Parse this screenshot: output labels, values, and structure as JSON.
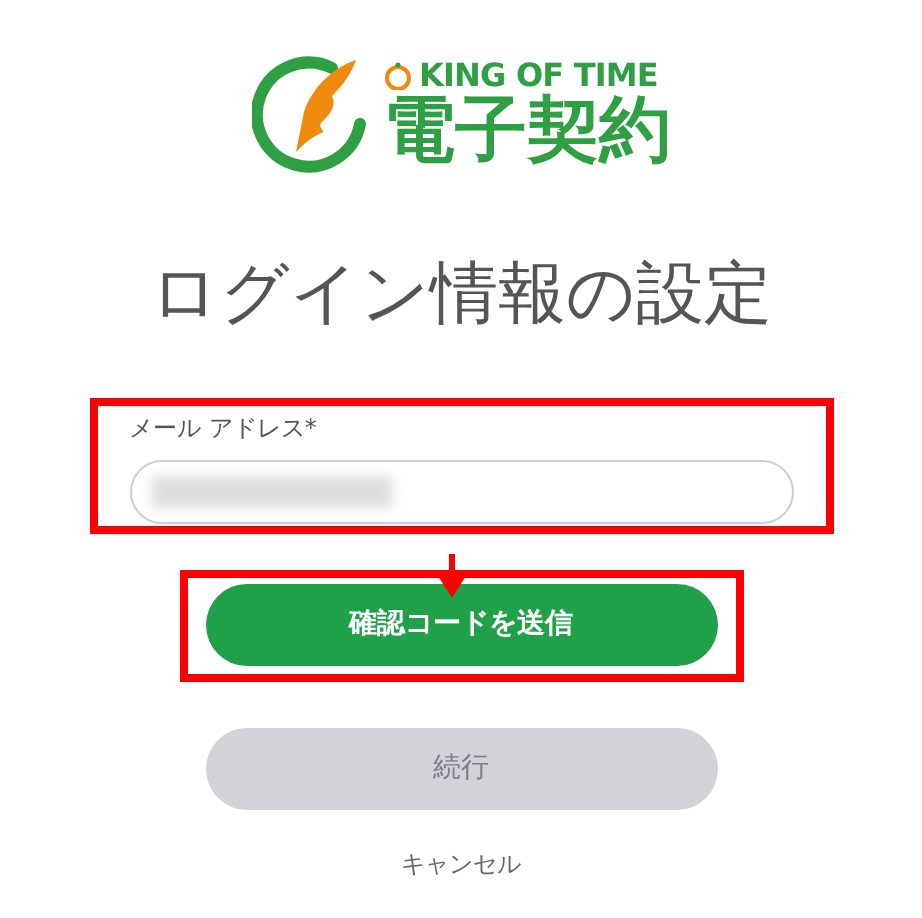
{
  "logo": {
    "brand": "KING OF TIME",
    "product": "電子契約"
  },
  "title": "ログイン情報の設定",
  "email_field": {
    "label": "メール アドレス*",
    "value_blurred": true,
    "highlighted": true
  },
  "annotation_arrow": true,
  "buttons": [
    {
      "label": "確認コードを送信",
      "disabled": false,
      "highlighted": true
    },
    {
      "label": "続行",
      "disabled": true,
      "highlighted": false
    }
  ],
  "cancel_link": "キャンセル"
}
